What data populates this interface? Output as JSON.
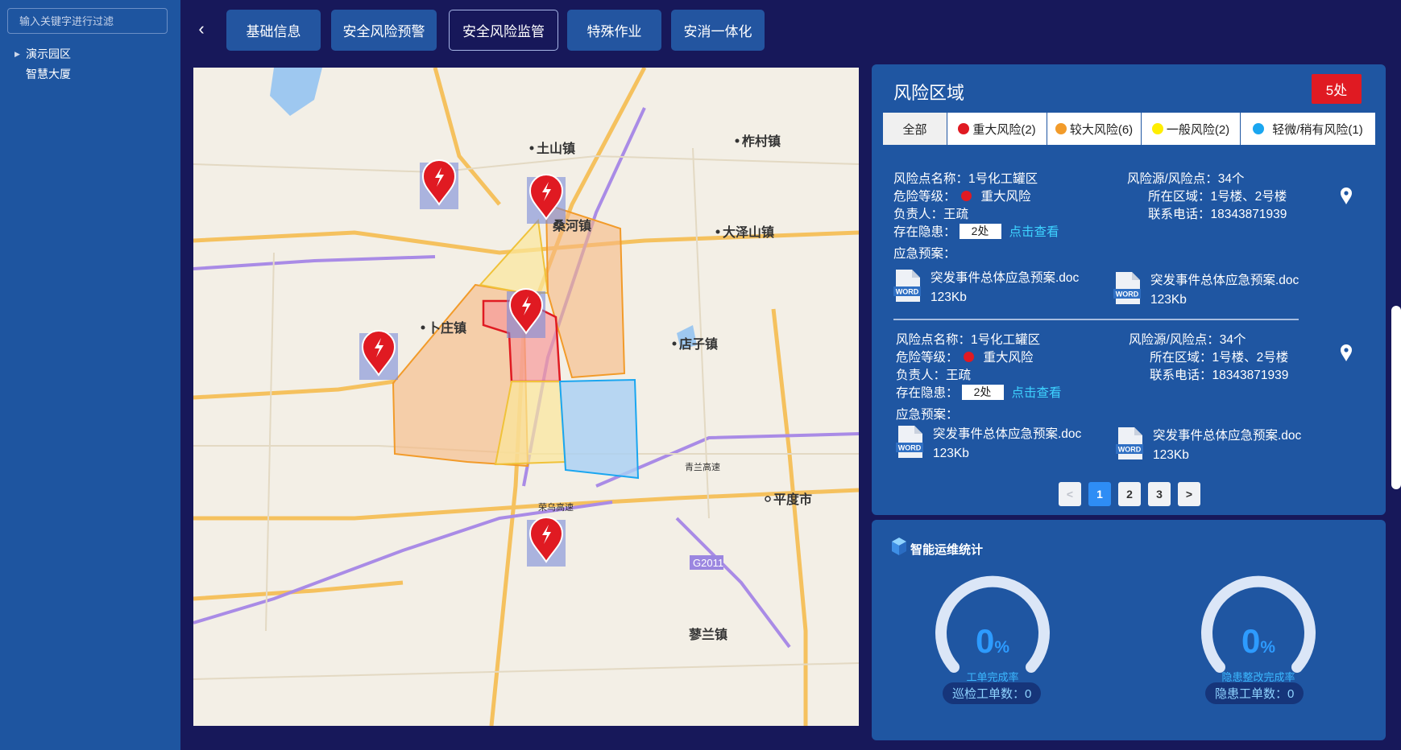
{
  "sidebar": {
    "filter_placeholder": "输入关键字进行过滤",
    "tree": [
      {
        "label": "演示园区",
        "expandable": true
      },
      {
        "label": "智慧大厦",
        "expandable": false
      }
    ]
  },
  "nav": {
    "tabs": [
      {
        "label": "基础信息",
        "active": false
      },
      {
        "label": "安全风险预警",
        "active": false
      },
      {
        "label": "安全风险监管",
        "active": true
      },
      {
        "label": "特殊作业",
        "active": false
      },
      {
        "label": "安消一体化",
        "active": false
      }
    ]
  },
  "map": {
    "labels": [
      "土山镇",
      "柞村镇",
      "桑河镇",
      "大泽山镇",
      "卜庄镇",
      "店子镇",
      "平度市",
      "蓼兰镇",
      "荣乌高速",
      "青兰高速",
      "G2011"
    ],
    "markers": 5
  },
  "risk": {
    "title": "风险区域",
    "count_badge": "5处",
    "filters": [
      {
        "label": "全部",
        "color": ""
      },
      {
        "label": "重大风险(2)",
        "color": "#e01a22"
      },
      {
        "label": "较大风险(6)",
        "color": "#f29b2a"
      },
      {
        "label": "一般风险(2)",
        "color": "#ffee00"
      },
      {
        "label": "轻微/稍有风险(1)",
        "color": "#1aa6f0"
      }
    ],
    "records": [
      {
        "name": "风险点名称：1号化工罐区",
        "level_label": "危险等级：",
        "level": "重大风险",
        "owner": "负责人：王疏",
        "hazard_label": "存在隐患：",
        "hazard_count": "2处",
        "hazard_link": "点击查看",
        "plan_label": "应急预案：",
        "source": "风险源/风险点：34个",
        "area": "所在区域：1号楼、2号楼",
        "phone": "联系电话：18343871939",
        "docs": [
          {
            "name": "突发事件总体应急预案.doc",
            "size": "123Kb"
          },
          {
            "name": "突发事件总体应急预案.doc",
            "size": "123Kb"
          }
        ]
      },
      {
        "name": "风险点名称：1号化工罐区",
        "level_label": "危险等级：",
        "level": "重大风险",
        "owner": "负责人：王疏",
        "hazard_label": "存在隐患：",
        "hazard_count": "2处",
        "hazard_link": "点击查看",
        "plan_label": "应急预案：",
        "source": "风险源/风险点：34个",
        "area": "所在区域：1号楼、2号楼",
        "phone": "联系电话：18343871939",
        "docs": [
          {
            "name": "突发事件总体应急预案.doc",
            "size": "123Kb"
          },
          {
            "name": "突发事件总体应急预案.doc",
            "size": "123Kb"
          }
        ]
      }
    ],
    "pagination": {
      "prev": "<",
      "pages": [
        "1",
        "2",
        "3"
      ],
      "current": "1",
      "next": ">"
    }
  },
  "stats": {
    "title": "智能运维统计",
    "gauges": [
      {
        "value": "0",
        "unit": "%",
        "label": "工单完成率",
        "count": "巡检工单数：0"
      },
      {
        "value": "0",
        "unit": "%",
        "label": "隐患整改完成率",
        "count": "隐患工单数：0"
      }
    ]
  },
  "colors": {
    "background": "#17185a",
    "panel": "#1f56a2",
    "sidebar": "#1e55a0",
    "accent": "#2e8df5",
    "danger": "#e01a22",
    "link": "#3ed2ff"
  }
}
